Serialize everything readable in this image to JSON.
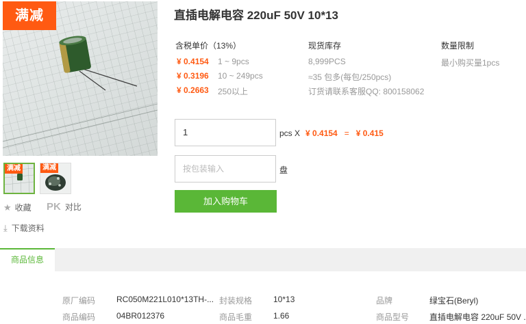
{
  "gallery": {
    "promo_badge": "满减",
    "thumbs": [
      {
        "badge": "满减"
      },
      {
        "badge": "满减"
      }
    ],
    "favorite_label": "收藏",
    "compare_mark": "PK",
    "compare_label": "对比",
    "download_label": "下载资料"
  },
  "product": {
    "title": "直插电解电容 220uF 50V 10*13"
  },
  "pricing": {
    "header": "含税单价（13%）",
    "tiers": [
      {
        "price": "¥ 0.4154",
        "range": "1 ~ 9pcs"
      },
      {
        "price": "¥ 0.3196",
        "range": "10 ~ 249pcs"
      },
      {
        "price": "¥ 0.2663",
        "range": "250以上"
      }
    ]
  },
  "stock": {
    "header": "现货库存",
    "quantity": "8,999PCS",
    "package": "≈35 包多(每包/250pcs)",
    "contact": "订货请联系客服QQ: 800158062"
  },
  "limit": {
    "header": "数量限制",
    "min": "最小购买量1pcs"
  },
  "order": {
    "qty_value": "1",
    "unit_label": "pcs X",
    "unit_price": "¥ 0.4154",
    "equals": "=",
    "total": "¥ 0.415",
    "pack_placeholder": "按包装输入",
    "pack_unit": "盘",
    "add_to_cart": "加入购物车"
  },
  "tabs": {
    "active": "商品信息"
  },
  "specs": {
    "rows": [
      [
        {
          "label": "原厂编码",
          "value": "RC050M221L010*13TH-..."
        },
        {
          "label": "封装规格",
          "value": "10*13"
        },
        {
          "label": "品牌",
          "value": "绿宝石(Beryl)"
        }
      ],
      [
        {
          "label": "商品编码",
          "value": "04BR012376"
        },
        {
          "label": "商品毛重",
          "value": "1.66"
        },
        {
          "label": "商品型号",
          "value": "直插电解电容 220uF 50V ..."
        }
      ]
    ]
  },
  "colors": {
    "accent_orange": "#ff5a12",
    "brand_green": "#5ab737",
    "capacitor_green": "#2e5b2c"
  }
}
